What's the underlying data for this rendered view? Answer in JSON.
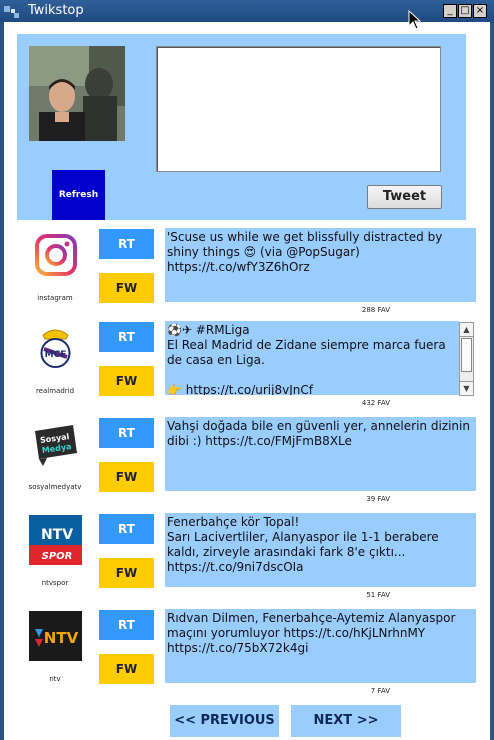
{
  "window": {
    "title": "Twikstop",
    "buttons": [
      "_",
      "□",
      "×"
    ]
  },
  "header": {
    "refresh_label": "Refresh",
    "tweet_label": "Tweet",
    "tweet_input_value": ""
  },
  "feed": [
    {
      "username": "instagram",
      "rt": "RT",
      "fw": "FW",
      "text": "'Scuse us while we get blissfully distracted by shiny things 😍 (via @PopSugar) https://t.co/wfY3Z6hOrz",
      "fav": "288 FAV",
      "brand_color": "#c13584"
    },
    {
      "username": "realmadrid",
      "rt": "RT",
      "fw": "FW",
      "text": "⚽️✈ #RMLiga\nEl Real Madrid de Zidane siempre marca fuera de casa en Liga.\n\n👉 https://t.co/urij8vJnCf",
      "fav": "432 FAV",
      "brand_color": "#1b2d6b"
    },
    {
      "username": "sosyalmedyatv",
      "rt": "RT",
      "fw": "FW",
      "text": "Vahşi doğada bile en güvenli yer, annelerin dizinin dibi :) https://t.co/FMjFmB8XLe",
      "fav": "39 FAV",
      "brand_color": "#1aa3a3"
    },
    {
      "username": "ntvspor",
      "rt": "RT",
      "fw": "FW",
      "text": "Fenerbahçe kör Topal!\nSarı Lacivertliler, Alanyaspor ile 1-1 berabere kaldı, zirveyle arasındaki fark 8'e çıktı... https://t.co/9ni7dscOIa",
      "fav": "51 FAV",
      "brand_color": "#005b96"
    },
    {
      "username": "ntv",
      "rt": "RT",
      "fw": "FW",
      "text": "Rıdvan Dilmen, Fenerbahçe-Aytemiz Alanyaspor maçını yorumluyor https://t.co/hKjLNrhnMY https://t.co/75bX72k4gi",
      "fav": "7 FAV",
      "brand_color": "#1a1a1a"
    }
  ],
  "pagination": {
    "prev_label": "<< PREVIOUS",
    "next_label": "NEXT >>"
  },
  "colors": {
    "panel": "#99ccff",
    "refresh": "#0000cc",
    "rt": "#3399ff",
    "fw": "#ffcc00"
  }
}
